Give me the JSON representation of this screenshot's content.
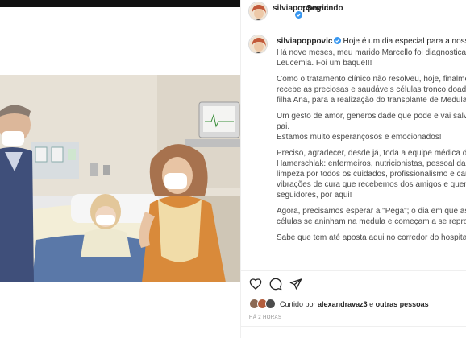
{
  "post": {
    "username": "silviapoppovic",
    "separator": "•",
    "follow_status": "Seguindo"
  },
  "caption": {
    "username": "silviapoppovic",
    "first_line": "Hoje é um dia especial para a nossa família",
    "lines": [
      "Há nove meses, meu marido Marcello foi diagnosticado com",
      "Leucemia. Foi um baque!!!",
      "",
      "Como o tratamento clínico não resolveu, hoje, finalmente, ele",
      "recebe as preciosas e saudáveis células tronco doadas por nossa",
      "filha Ana, para a realização do transplante de Medula Óssea.",
      "",
      "Um gesto de amor, generosidade que pode e vai salvar a vida do",
      "pai.",
      "Estamos muito esperançosos e emocionados!",
      "",
      "Preciso, agradecer, desde já, toda a equipe médica do Dr Nelson",
      "Hamerschlak: enfermeiros, nutricionistas, pessoal da copa,",
      "limpeza por todos os cuidados, profissionalismo e carinho e",
      "vibrações de cura que recebemos dos amigos e queridos",
      "seguidores, por aqui!",
      "",
      "Agora, precisamos esperar a \"Pega\"; o dia em que as novas",
      "células se aninham na medula e começam a se reproduzir!",
      "",
      "Sabe que tem até aposta aqui no corredor do hospital?"
    ]
  },
  "actions": {
    "like_icon": "heart-icon",
    "comment_icon": "comment-icon",
    "share_icon": "send-icon"
  },
  "likes": {
    "prefix": "Curtido por",
    "first_user": "alexandravaz3",
    "connector": "e",
    "others": "outras pessoas"
  },
  "timestamp": "HÁ 2 HORAS",
  "colors": {
    "verified_blue": "#3897f0",
    "text_dark": "#262626",
    "text_muted": "#8e8e8e",
    "top_bar": "#111111"
  }
}
